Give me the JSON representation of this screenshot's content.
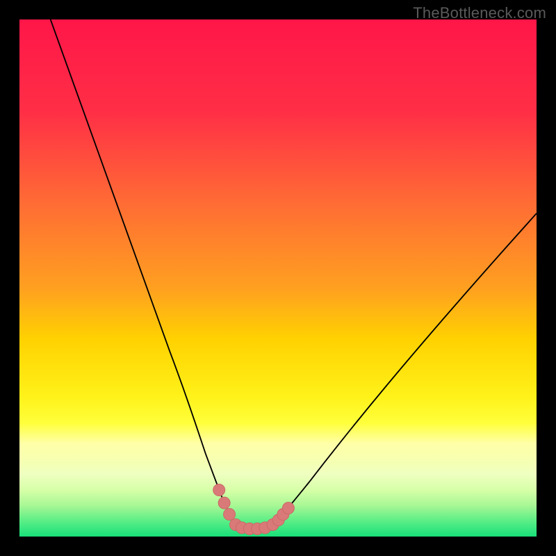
{
  "watermark": "TheBottleneck.com",
  "colors": {
    "band_top": "#ff1648",
    "band_mid1": "#ff6a35",
    "band_mid2": "#ffd200",
    "band_mid3": "#ffff3a",
    "band_low1": "#f7ffb0",
    "band_low2": "#d6ffa8",
    "band_bottom": "#18e07a",
    "curve": "#000000",
    "markers": "#d97a78",
    "frame": "#000000"
  },
  "chart_data": {
    "type": "line",
    "title": "",
    "xlabel": "",
    "ylabel": "",
    "xlim": [
      0,
      100
    ],
    "ylim": [
      0,
      100
    ],
    "series": [
      {
        "name": "left_branch",
        "x": [
          6,
          10,
          14,
          18,
          22,
          26,
          29,
          32,
          34,
          36,
          37.5,
          38.6,
          39.6,
          40.6,
          41.8
        ],
        "values": [
          100,
          89,
          78,
          67,
          56,
          45,
          36,
          28,
          22,
          16,
          12,
          9,
          6.5,
          4.3,
          2.3
        ]
      },
      {
        "name": "trough",
        "x": [
          41.8,
          43.0,
          44.5,
          46.0,
          47.5,
          49.0
        ],
        "values": [
          2.3,
          1.7,
          1.5,
          1.5,
          1.7,
          2.3
        ]
      },
      {
        "name": "right_branch",
        "x": [
          49.0,
          51,
          53,
          56,
          60,
          65,
          71,
          78,
          86,
          94,
          100
        ],
        "values": [
          2.3,
          4.3,
          6.8,
          10.5,
          15.7,
          22.0,
          29.2,
          37.6,
          46.8,
          55.8,
          62.5
        ]
      }
    ],
    "markers": {
      "name": "highlighted_points",
      "x": [
        38.6,
        39.6,
        40.6,
        41.8,
        43.0,
        44.5,
        46.0,
        47.5,
        49.0,
        50.1,
        51.0,
        52.0
      ],
      "values": [
        9.0,
        6.5,
        4.3,
        2.3,
        1.7,
        1.5,
        1.5,
        1.7,
        2.3,
        3.2,
        4.3,
        5.5
      ]
    },
    "gradient_bands_pct_from_top": [
      {
        "stop": 0,
        "color": "#ff1648"
      },
      {
        "stop": 35,
        "color": "#ff6a35"
      },
      {
        "stop": 62,
        "color": "#ffd200"
      },
      {
        "stop": 78,
        "color": "#ffff3a"
      },
      {
        "stop": 85,
        "color": "#f7ffb0"
      },
      {
        "stop": 93,
        "color": "#d6ffa8"
      },
      {
        "stop": 100,
        "color": "#18e07a"
      }
    ]
  }
}
